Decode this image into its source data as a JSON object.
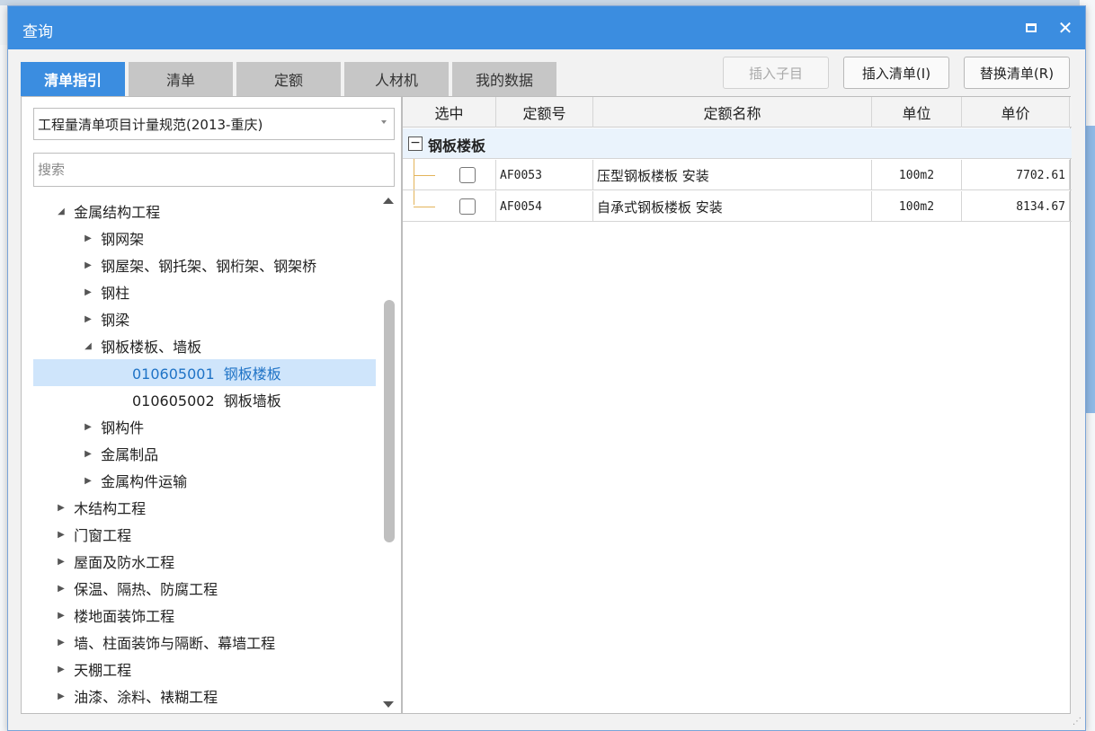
{
  "dialog": {
    "title": "查询",
    "close_symbol": "✕"
  },
  "tabs": [
    {
      "label": "清单指引",
      "active": true
    },
    {
      "label": "清单",
      "active": false
    },
    {
      "label": "定额",
      "active": false
    },
    {
      "label": "人材机",
      "active": false
    },
    {
      "label": "我的数据",
      "active": false
    }
  ],
  "actions": {
    "insert_sub": "插入子目",
    "insert_list": "插入清单(I)",
    "replace_list": "替换清单(R)"
  },
  "left": {
    "spec_select": "工程量清单项目计量规范(2013-重庆)",
    "search_placeholder": "搜索",
    "tree": [
      {
        "label": "金属结构工程",
        "arrow": "◢",
        "level": 1
      },
      {
        "label": "钢网架",
        "arrow": "▶",
        "level": 2
      },
      {
        "label": "钢屋架、钢托架、钢桁架、钢架桥",
        "arrow": "▶",
        "level": 2
      },
      {
        "label": "钢柱",
        "arrow": "▶",
        "level": 2
      },
      {
        "label": "钢梁",
        "arrow": "▶",
        "level": 2
      },
      {
        "label": "钢板楼板、墙板",
        "arrow": "◢",
        "level": 2
      },
      {
        "label": "010605001  钢板楼板",
        "arrow": "",
        "level": 3,
        "selected": true
      },
      {
        "label": "010605002  钢板墙板",
        "arrow": "",
        "level": 3
      },
      {
        "label": "钢构件",
        "arrow": "▶",
        "level": 2
      },
      {
        "label": "金属制品",
        "arrow": "▶",
        "level": 2
      },
      {
        "label": "金属构件运输",
        "arrow": "▶",
        "level": 2
      },
      {
        "label": "木结构工程",
        "arrow": "▶",
        "level": 1
      },
      {
        "label": "门窗工程",
        "arrow": "▶",
        "level": 1
      },
      {
        "label": "屋面及防水工程",
        "arrow": "▶",
        "level": 1
      },
      {
        "label": "保温、隔热、防腐工程",
        "arrow": "▶",
        "level": 1
      },
      {
        "label": "楼地面装饰工程",
        "arrow": "▶",
        "level": 1
      },
      {
        "label": "墙、柱面装饰与隔断、幕墙工程",
        "arrow": "▶",
        "level": 1
      },
      {
        "label": "天棚工程",
        "arrow": "▶",
        "level": 1
      },
      {
        "label": "油漆、涂料、裱糊工程",
        "arrow": "▶",
        "level": 1
      }
    ]
  },
  "grid": {
    "headers": [
      "选中",
      "定额号",
      "定额名称",
      "单位",
      "单价"
    ],
    "group": {
      "toggle": "−",
      "label": "钢板楼板"
    },
    "rows": [
      {
        "code": "AF0053",
        "name": "压型钢板楼板 安装",
        "unit": "100m2",
        "price": "7702.61"
      },
      {
        "code": "AF0054",
        "name": "自承式钢板楼板 安装",
        "unit": "100m2",
        "price": "8134.67"
      }
    ]
  }
}
